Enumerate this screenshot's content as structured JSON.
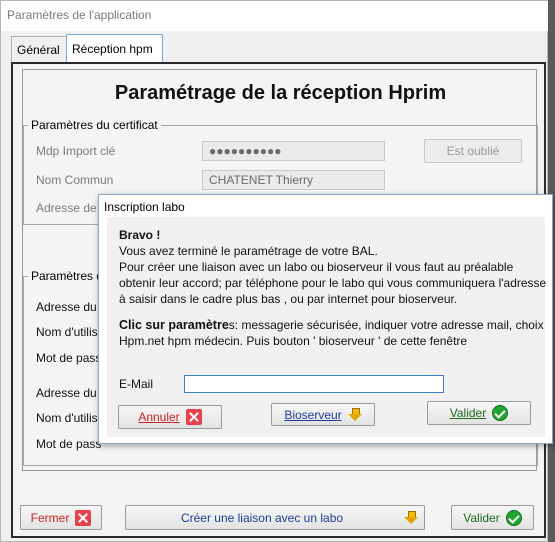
{
  "window": {
    "title": "Paramètres de l'application"
  },
  "tabs": [
    {
      "label": "Général"
    },
    {
      "label": "Réception hpm"
    }
  ],
  "page": {
    "title": "Paramétrage de la réception Hprim"
  },
  "certificat": {
    "legend": "Paramètres du certificat",
    "mdp_label": "Mdp Import clé",
    "mdp_value": "●●●●●●●●●●",
    "forgot_label": "Est oublié",
    "nom_label": "Nom Commun",
    "nom_value": "CHATENET Thierry",
    "adresse_label": "Adresse de"
  },
  "group2": {
    "legend": "Paramètres d",
    "rows": [
      "Adresse du",
      "Nom d'utilisa",
      "Mot de pass",
      "Adresse du",
      "Nom d'utilisa",
      "Mot de pass"
    ]
  },
  "footer": {
    "close_label": "Fermer",
    "link_label": "Créer une liaison avec un labo",
    "validate_label": "Valider"
  },
  "dialog": {
    "title": "Inscription labo",
    "bravo": "Bravo !",
    "p1": "Vous avez terminé le paramétrage de votre BAL.",
    "p2": "Pour créer une liaison avec un labo ou bioserveur il vous faut au préalable obtenir leur accord; par téléphone pour le labo qui vous communiquera l'adresse à saisir dans le cadre plus bas , ou par internet pour bioserveur.",
    "p3_bold": "Clic sur paramètre",
    "p3_rest": "s: messagerie sécurisée, indiquer votre adresse mail, choix Hpm.net hpm médecin. Puis bouton ' bioserveur ' de cette fenêtre",
    "email_label": "E-Mail",
    "email_value": "",
    "cancel_label": "Annuler",
    "bioserveur_label": "Bioserveur",
    "validate_label": "Valider"
  },
  "colors": {
    "accent_border": "#7aa7d8",
    "close_red": "#e8404f",
    "ok_green": "#22a532",
    "arrow_yellow": "#f2b90c"
  }
}
